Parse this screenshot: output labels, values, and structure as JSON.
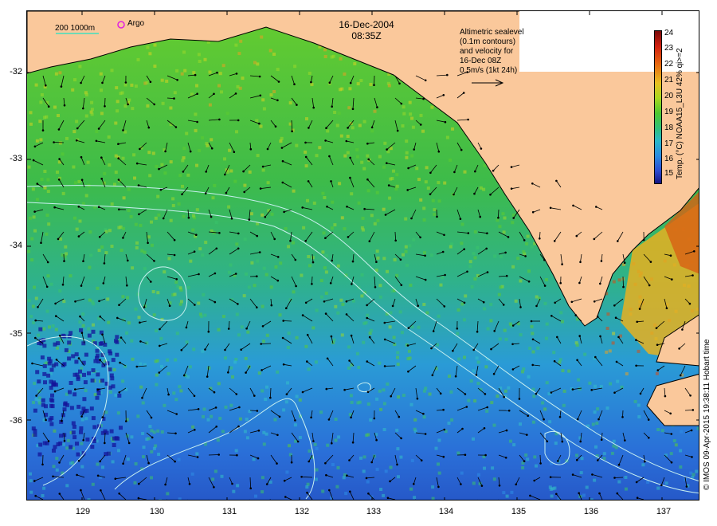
{
  "header": {
    "date": "16-Dec-2004",
    "time": "08:35Z"
  },
  "legend": {
    "scale_text": "200  1000m",
    "argo_label": "Argo",
    "info_lines": [
      "Altimetric sealevel",
      "(0.1m contours)",
      "and velocity for",
      "16-Dec 08Z",
      "0.5m/s (1kt 24h)"
    ]
  },
  "colorbar": {
    "title": "Temp. (°C) NOAA15_L3U 42% qi>=2",
    "labels": [
      "24",
      "23",
      "22",
      "21",
      "20",
      "19",
      "18",
      "17",
      "16",
      "15"
    ],
    "min": 14.5,
    "max": 24
  },
  "axes": {
    "x_labels": [
      "129",
      "130",
      "131",
      "132",
      "133",
      "134",
      "135",
      "136",
      "137"
    ],
    "y_labels": [
      "-32",
      "-33",
      "-34",
      "-35",
      "-36"
    ],
    "lon_range": [
      128.2,
      137.5
    ],
    "lat_range": [
      -36.9,
      -31.4
    ]
  },
  "credit": "© IMOS 09-Apr-2015 19:38:11 Hobart time",
  "colors": {
    "land": "#fac89b",
    "ocean_warm": "#66cc33",
    "ocean_cool": "#2a8be0",
    "contour": "#bfeeee"
  }
}
